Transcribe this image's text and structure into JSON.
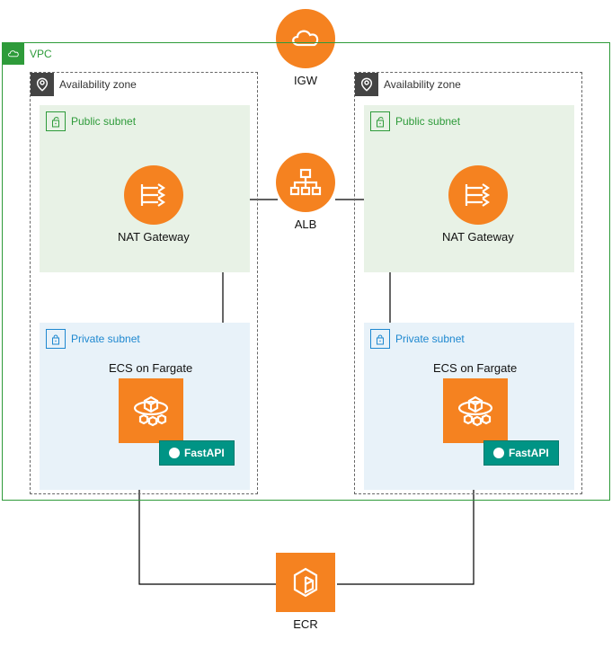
{
  "vpc": {
    "label": "VPC"
  },
  "igw": {
    "label": "IGW"
  },
  "alb": {
    "label": "ALB"
  },
  "ecr": {
    "label": "ECR"
  },
  "az": {
    "left": {
      "label": "Availability zone"
    },
    "right": {
      "label": "Availability zone"
    }
  },
  "subnet": {
    "public": {
      "label": "Public subnet"
    },
    "private": {
      "label": "Private subnet"
    }
  },
  "nat": {
    "label": "NAT Gateway"
  },
  "ecs": {
    "label": "ECS on Fargate"
  },
  "fastapi": {
    "label": "FastAPI"
  },
  "colors": {
    "aws_orange": "#f58220",
    "vpc_green": "#2e9b3a",
    "subnet_blue": "#1e88d0",
    "fastapi_teal": "#009485"
  }
}
